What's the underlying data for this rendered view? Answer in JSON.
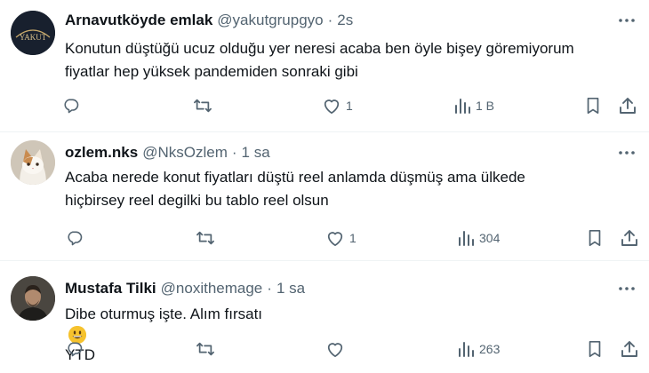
{
  "tweets": [
    {
      "name": "Arnavutköyde emlak",
      "handle": "@yakutgrupgyo",
      "time": "2s",
      "avatar_text": "YAKUT",
      "text_lines": [
        "Konutun düştüğü ucuz olduğu yer neresi acaba ben öyle bişey göremiyorum",
        "fiyatlar hep yüksek pandemiden sonraki gibi"
      ],
      "likes": "1",
      "views": "1 B"
    },
    {
      "name": "ozlem.nks",
      "handle": "@NksOzlem",
      "time": "1 sa",
      "text_lines": [
        "Acaba nerede konut fiyatları düştü reel anlamda düşmüş ama ülkede",
        "hiçbirsey reel degilki bu tablo reel olsun"
      ],
      "likes": "1",
      "views": "304"
    },
    {
      "name": "Mustafa Tilki",
      "handle": "@noxithemage",
      "time": "1 sa",
      "text_before_emoji": "Dibe oturmuş işte. Alım fırsatı",
      "text_after_emoji": "YTD",
      "likes": "",
      "views": "263"
    }
  ],
  "dot": "·",
  "colors": {
    "text": "#0f1419",
    "secondary": "#536471",
    "divider": "#eff3f4"
  },
  "icons": [
    "more-icon",
    "reply-icon",
    "retweet-icon",
    "like-icon",
    "views-icon",
    "bookmark-icon",
    "share-icon"
  ]
}
